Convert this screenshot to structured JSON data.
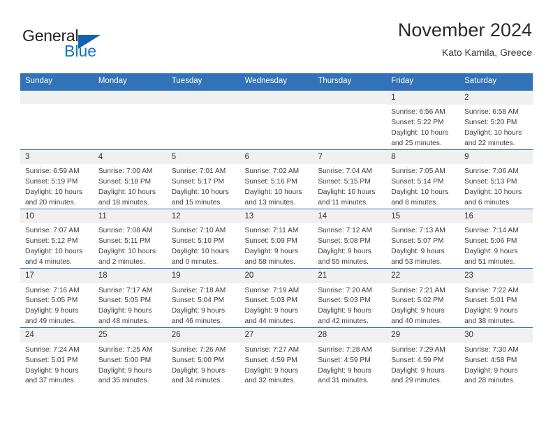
{
  "brand": {
    "name_part1": "General",
    "name_part2": "Blue",
    "logo_icon": "triangle-flag-icon",
    "accent_color": "#1273c4"
  },
  "header": {
    "title": "November 2024",
    "subtitle": "Kato Kamila, Greece"
  },
  "theme": {
    "header_blue": "#3272b8",
    "daynum_band": "#f0f0f0",
    "text": "#3b3b3b"
  },
  "calendar": {
    "weekday_headers": [
      "Sunday",
      "Monday",
      "Tuesday",
      "Wednesday",
      "Thursday",
      "Friday",
      "Saturday"
    ],
    "weeks": [
      [
        {
          "day": "",
          "lines": []
        },
        {
          "day": "",
          "lines": []
        },
        {
          "day": "",
          "lines": []
        },
        {
          "day": "",
          "lines": []
        },
        {
          "day": "",
          "lines": []
        },
        {
          "day": "1",
          "lines": [
            "Sunrise: 6:56 AM",
            "Sunset: 5:22 PM",
            "Daylight: 10 hours",
            "and 25 minutes."
          ]
        },
        {
          "day": "2",
          "lines": [
            "Sunrise: 6:58 AM",
            "Sunset: 5:20 PM",
            "Daylight: 10 hours",
            "and 22 minutes."
          ]
        }
      ],
      [
        {
          "day": "3",
          "lines": [
            "Sunrise: 6:59 AM",
            "Sunset: 5:19 PM",
            "Daylight: 10 hours",
            "and 20 minutes."
          ]
        },
        {
          "day": "4",
          "lines": [
            "Sunrise: 7:00 AM",
            "Sunset: 5:18 PM",
            "Daylight: 10 hours",
            "and 18 minutes."
          ]
        },
        {
          "day": "5",
          "lines": [
            "Sunrise: 7:01 AM",
            "Sunset: 5:17 PM",
            "Daylight: 10 hours",
            "and 15 minutes."
          ]
        },
        {
          "day": "6",
          "lines": [
            "Sunrise: 7:02 AM",
            "Sunset: 5:16 PM",
            "Daylight: 10 hours",
            "and 13 minutes."
          ]
        },
        {
          "day": "7",
          "lines": [
            "Sunrise: 7:04 AM",
            "Sunset: 5:15 PM",
            "Daylight: 10 hours",
            "and 11 minutes."
          ]
        },
        {
          "day": "8",
          "lines": [
            "Sunrise: 7:05 AM",
            "Sunset: 5:14 PM",
            "Daylight: 10 hours",
            "and 8 minutes."
          ]
        },
        {
          "day": "9",
          "lines": [
            "Sunrise: 7:06 AM",
            "Sunset: 5:13 PM",
            "Daylight: 10 hours",
            "and 6 minutes."
          ]
        }
      ],
      [
        {
          "day": "10",
          "lines": [
            "Sunrise: 7:07 AM",
            "Sunset: 5:12 PM",
            "Daylight: 10 hours",
            "and 4 minutes."
          ]
        },
        {
          "day": "11",
          "lines": [
            "Sunrise: 7:08 AM",
            "Sunset: 5:11 PM",
            "Daylight: 10 hours",
            "and 2 minutes."
          ]
        },
        {
          "day": "12",
          "lines": [
            "Sunrise: 7:10 AM",
            "Sunset: 5:10 PM",
            "Daylight: 10 hours",
            "and 0 minutes."
          ]
        },
        {
          "day": "13",
          "lines": [
            "Sunrise: 7:11 AM",
            "Sunset: 5:09 PM",
            "Daylight: 9 hours",
            "and 58 minutes."
          ]
        },
        {
          "day": "14",
          "lines": [
            "Sunrise: 7:12 AM",
            "Sunset: 5:08 PM",
            "Daylight: 9 hours",
            "and 55 minutes."
          ]
        },
        {
          "day": "15",
          "lines": [
            "Sunrise: 7:13 AM",
            "Sunset: 5:07 PM",
            "Daylight: 9 hours",
            "and 53 minutes."
          ]
        },
        {
          "day": "16",
          "lines": [
            "Sunrise: 7:14 AM",
            "Sunset: 5:06 PM",
            "Daylight: 9 hours",
            "and 51 minutes."
          ]
        }
      ],
      [
        {
          "day": "17",
          "lines": [
            "Sunrise: 7:16 AM",
            "Sunset: 5:05 PM",
            "Daylight: 9 hours",
            "and 49 minutes."
          ]
        },
        {
          "day": "18",
          "lines": [
            "Sunrise: 7:17 AM",
            "Sunset: 5:05 PM",
            "Daylight: 9 hours",
            "and 48 minutes."
          ]
        },
        {
          "day": "19",
          "lines": [
            "Sunrise: 7:18 AM",
            "Sunset: 5:04 PM",
            "Daylight: 9 hours",
            "and 46 minutes."
          ]
        },
        {
          "day": "20",
          "lines": [
            "Sunrise: 7:19 AM",
            "Sunset: 5:03 PM",
            "Daylight: 9 hours",
            "and 44 minutes."
          ]
        },
        {
          "day": "21",
          "lines": [
            "Sunrise: 7:20 AM",
            "Sunset: 5:03 PM",
            "Daylight: 9 hours",
            "and 42 minutes."
          ]
        },
        {
          "day": "22",
          "lines": [
            "Sunrise: 7:21 AM",
            "Sunset: 5:02 PM",
            "Daylight: 9 hours",
            "and 40 minutes."
          ]
        },
        {
          "day": "23",
          "lines": [
            "Sunrise: 7:22 AM",
            "Sunset: 5:01 PM",
            "Daylight: 9 hours",
            "and 38 minutes."
          ]
        }
      ],
      [
        {
          "day": "24",
          "lines": [
            "Sunrise: 7:24 AM",
            "Sunset: 5:01 PM",
            "Daylight: 9 hours",
            "and 37 minutes."
          ]
        },
        {
          "day": "25",
          "lines": [
            "Sunrise: 7:25 AM",
            "Sunset: 5:00 PM",
            "Daylight: 9 hours",
            "and 35 minutes."
          ]
        },
        {
          "day": "26",
          "lines": [
            "Sunrise: 7:26 AM",
            "Sunset: 5:00 PM",
            "Daylight: 9 hours",
            "and 34 minutes."
          ]
        },
        {
          "day": "27",
          "lines": [
            "Sunrise: 7:27 AM",
            "Sunset: 4:59 PM",
            "Daylight: 9 hours",
            "and 32 minutes."
          ]
        },
        {
          "day": "28",
          "lines": [
            "Sunrise: 7:28 AM",
            "Sunset: 4:59 PM",
            "Daylight: 9 hours",
            "and 31 minutes."
          ]
        },
        {
          "day": "29",
          "lines": [
            "Sunrise: 7:29 AM",
            "Sunset: 4:59 PM",
            "Daylight: 9 hours",
            "and 29 minutes."
          ]
        },
        {
          "day": "30",
          "lines": [
            "Sunrise: 7:30 AM",
            "Sunset: 4:58 PM",
            "Daylight: 9 hours",
            "and 28 minutes."
          ]
        }
      ]
    ]
  }
}
